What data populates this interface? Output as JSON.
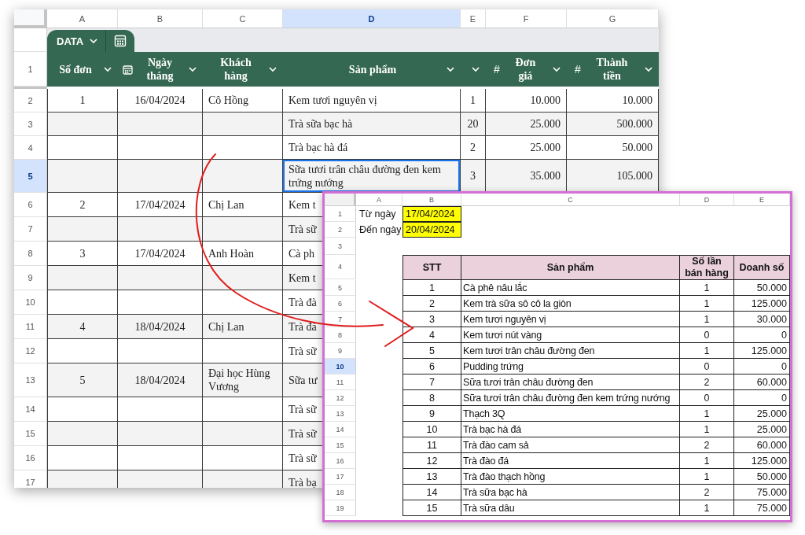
{
  "main_sheet": {
    "column_letters": [
      {
        "label": "A",
        "selected": false
      },
      {
        "label": "B",
        "selected": false
      },
      {
        "label": "C",
        "selected": false
      },
      {
        "label": "D",
        "selected": true
      },
      {
        "label": "E",
        "selected": false
      },
      {
        "label": "F",
        "selected": false
      },
      {
        "label": "G",
        "selected": false
      }
    ],
    "table_name": "DATA",
    "header": {
      "number": "1",
      "columns": [
        {
          "kind": "text",
          "label": "Số đơn"
        },
        {
          "kind": "date",
          "label": "Ngày tháng"
        },
        {
          "kind": "text",
          "label": "Khách hàng"
        },
        {
          "kind": "center",
          "label": "Sản phẩm"
        },
        {
          "kind": "text"
        },
        {
          "kind": "number",
          "symbol": "#",
          "label": "Đơn giá"
        },
        {
          "kind": "number",
          "symbol": "#",
          "label": "Thành tiền"
        }
      ]
    },
    "rows": [
      {
        "number": "2",
        "selected": false,
        "cells": {
          "A": "1",
          "B": "16/04/2024",
          "C": "Cô Hồng",
          "D": "Kem tươi nguyên vị",
          "E": "1",
          "F": "10.000",
          "G": "10.000"
        }
      },
      {
        "number": "3",
        "selected": false,
        "cells": {
          "D": "Trà sữa bạc hà",
          "E": "20",
          "F": "25.000",
          "G": "500.000"
        }
      },
      {
        "number": "4",
        "selected": false,
        "cells": {
          "D": "Trà bạc hà đá",
          "E": "2",
          "F": "25.000",
          "G": "50.000"
        }
      },
      {
        "number": "5",
        "selected": true,
        "cells": {
          "D": "Sữa tươi trân châu đường đen kem trứng nướng",
          "E": "3",
          "F": "35.000",
          "G": "105.000"
        }
      },
      {
        "number": "6",
        "selected": false,
        "cells": {
          "A": "2",
          "B": "17/04/2024",
          "C": "Chị Lan",
          "D": "Kem t"
        }
      },
      {
        "number": "7",
        "selected": false,
        "cells": {
          "D": "Trà sữ"
        }
      },
      {
        "number": "8",
        "selected": false,
        "cells": {
          "A": "3",
          "B": "17/04/2024",
          "C": "Anh Hoàn",
          "D": "Cà ph"
        }
      },
      {
        "number": "9",
        "selected": false,
        "cells": {
          "D": "Kem t"
        }
      },
      {
        "number": "10",
        "selected": false,
        "cells": {
          "D": "Trà đà"
        }
      },
      {
        "number": "11",
        "selected": false,
        "cells": {
          "A": "4",
          "B": "18/04/2024",
          "C": "Chị Lan",
          "D": "Trà đà"
        }
      },
      {
        "number": "12",
        "selected": false,
        "cells": {
          "D": "Trà sữ"
        }
      },
      {
        "number": "13",
        "selected": false,
        "cells": {
          "A": "5",
          "B": "18/04/2024",
          "C": "Đại học Hùng Vương",
          "D": "Sữa tư"
        }
      },
      {
        "number": "14",
        "selected": false,
        "cells": {
          "D": "Trà sữ"
        }
      },
      {
        "number": "15",
        "selected": false,
        "cells": {
          "D": "Trà sữ"
        }
      },
      {
        "number": "16",
        "selected": false,
        "cells": {
          "D": "Trà sữ"
        }
      },
      {
        "number": "17",
        "selected": false,
        "cells": {
          "D": "Trà bạ"
        }
      }
    ]
  },
  "report_sheet": {
    "column_letters": [
      {
        "label": "A",
        "selected": false
      },
      {
        "label": "B",
        "selected": false
      },
      {
        "label": "C",
        "selected": false
      },
      {
        "label": "D",
        "selected": false
      },
      {
        "label": "E",
        "selected": false
      }
    ],
    "row_numbers": [
      {
        "label": "1",
        "selected": false
      },
      {
        "label": "2",
        "selected": false
      },
      {
        "label": "3",
        "selected": false
      },
      {
        "label": "4",
        "selected": false
      },
      {
        "label": "5",
        "selected": false
      },
      {
        "label": "6",
        "selected": false
      },
      {
        "label": "7",
        "selected": false
      },
      {
        "label": "8",
        "selected": false
      },
      {
        "label": "9",
        "selected": false
      },
      {
        "label": "10",
        "selected": true
      },
      {
        "label": "11",
        "selected": false
      },
      {
        "label": "12",
        "selected": false
      },
      {
        "label": "13",
        "selected": false
      },
      {
        "label": "14",
        "selected": false
      },
      {
        "label": "15",
        "selected": false
      },
      {
        "label": "16",
        "selected": false
      },
      {
        "label": "17",
        "selected": false
      },
      {
        "label": "18",
        "selected": false
      },
      {
        "label": "19",
        "selected": false
      }
    ],
    "date_filters": [
      {
        "label": "Từ ngày",
        "value": "17/04/2024"
      },
      {
        "label": "Đến ngày",
        "value": "20/04/2024"
      }
    ],
    "table": {
      "columns": [
        "STT",
        "Sản phẩm",
        "Số lần bán hàng",
        "Doanh số"
      ],
      "rows": [
        [
          "1",
          "Cà phê nâu lắc",
          "1",
          "50.000"
        ],
        [
          "2",
          "Kem trà sữa sô cô la giòn",
          "1",
          "125.000"
        ],
        [
          "3",
          "Kem tươi nguyên vị",
          "1",
          "30.000"
        ],
        [
          "4",
          "Kem tươi nút vàng",
          "0",
          "0"
        ],
        [
          "5",
          "Kem tươi trân châu đường đen",
          "1",
          "125.000"
        ],
        [
          "6",
          "Pudding trứng",
          "0",
          "0"
        ],
        [
          "7",
          "Sữa tươi trân châu đường đen",
          "2",
          "60.000"
        ],
        [
          "8",
          "Sữa tươi trân châu đường đen kem trứng nướng",
          "0",
          "0"
        ],
        [
          "9",
          "Thạch 3Q",
          "1",
          "25.000"
        ],
        [
          "10",
          "Trà bạc hà đá",
          "1",
          "25.000"
        ],
        [
          "11",
          "Trà đào cam sả",
          "2",
          "60.000"
        ],
        [
          "12",
          "Trà đào đá",
          "1",
          "125.000"
        ],
        [
          "13",
          "Trà đào thạch hồng",
          "1",
          "50.000"
        ],
        [
          "14",
          "Trà sữa bạc hà",
          "2",
          "75.000"
        ],
        [
          "15",
          "Trà sữa dâu",
          "1",
          "75.000"
        ]
      ]
    }
  }
}
